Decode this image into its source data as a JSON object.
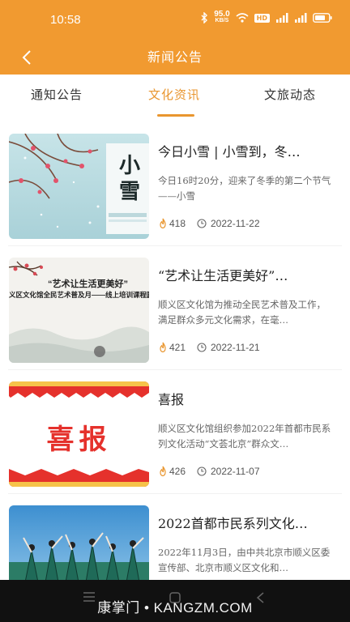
{
  "status_bar": {
    "time": "10:58",
    "net_speed_value": "95.0",
    "net_speed_unit": "KB/S",
    "hd_badge": "HD",
    "signal1_label": "4G",
    "signal2_label": "4G"
  },
  "header": {
    "title": "新闻公告",
    "back_icon": "chevron-left-icon"
  },
  "tabs": [
    {
      "label": "通知公告",
      "active": false
    },
    {
      "label": "文化资讯",
      "active": true
    },
    {
      "label": "文旅动态",
      "active": false
    }
  ],
  "articles": [
    {
      "title": "今日小雪 | 小雪到，冬…",
      "summary": "今日16时20分，迎来了冬季的第二个节气——小雪",
      "views": "418",
      "date": "2022-11-22",
      "thumb_text": "小雪"
    },
    {
      "title": "“艺术让生活更美好”…",
      "summary": "顺义区文化馆为推动全民艺术普及工作，满足群众多元文化需求，在毫…",
      "views": "421",
      "date": "2022-11-21",
      "thumb_text": "“艺术让生活更美好”",
      "thumb_subtext": "义区文化馆全民艺术普及月——线上培训课程圆满结"
    },
    {
      "title": "喜报",
      "summary": "顺义区文化馆组织参加2022年首都市民系列文化活动“文荟北京”群众文…",
      "views": "426",
      "date": "2022-11-07",
      "thumb_text": "喜报"
    },
    {
      "title": "2022首都市民系列文化…",
      "summary": "2022年11月3日，由中共北京市顺义区委宣传部、北京市顺义区文化和…",
      "views": "",
      "date": "",
      "thumb_text": ""
    }
  ],
  "watermark": "康掌门 • KANGZM.COM",
  "colors": {
    "brand": "#F19A30",
    "tab_active": "#E9962F",
    "festive_red": "#E5312C"
  }
}
